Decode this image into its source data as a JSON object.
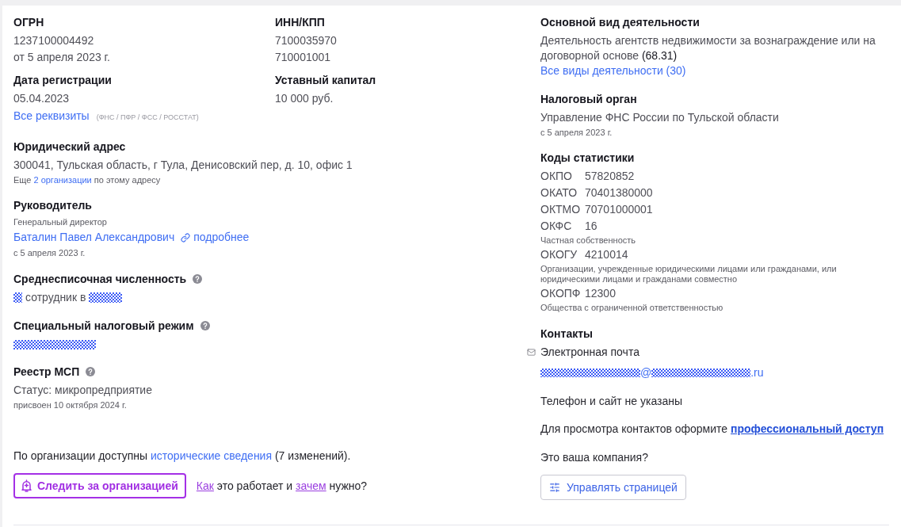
{
  "requisites": {
    "ogrn": {
      "label": "ОГРН",
      "values": [
        "1237100004492",
        "от 5 апреля 2023 г."
      ]
    },
    "inn_kpp": {
      "label": "ИНН/КПП",
      "values": [
        "7100035970",
        "710001001"
      ]
    },
    "registration_date": {
      "label": "Дата регистрации",
      "value": "05.04.2023"
    },
    "charter_capital": {
      "label": "Уставный капитал",
      "value": "10 000 руб."
    },
    "all_requisites": {
      "link": "Все реквизиты",
      "sources": "(ФНС / ПФР / ФСС / РОССТАТ)"
    }
  },
  "legal_address": {
    "label": "Юридический адрес",
    "value": "300041, Тульская область, г Тула, Денисовский пер, д. 10, офис 1",
    "note": {
      "before": "Еще",
      "link": "2 организации",
      "after": "по этому адресу"
    }
  },
  "director": {
    "label": "Руководитель",
    "position": "Генеральный директор",
    "name": "Баталин Павел Александрович",
    "details_link": "подробнее",
    "since": "с 5 апреля 2023 г."
  },
  "headcount": {
    "label": "Среднесписочная численность",
    "help": true,
    "parts": [
      {
        "kind": "masked"
      },
      {
        "kind": "text",
        "text": "сотрудник в"
      },
      {
        "kind": "masked"
      }
    ]
  },
  "tax_regime": {
    "label": "Специальный налоговый режим",
    "help": true,
    "parts": [
      {
        "kind": "masked"
      }
    ]
  },
  "sme_registry": {
    "label": "Реестр МСП",
    "help": true,
    "status": "Статус: микропредприятие",
    "assigned": "присвоен 10 октября 2024 г."
  },
  "history": {
    "before": "По организации доступны",
    "link": "исторические сведения",
    "after": "(7 изменений)."
  },
  "follow": {
    "button": "Следить за организацией",
    "help": {
      "link_1": "Как",
      "middle": "это работает и",
      "link_2": "зачем",
      "after": "нужно?"
    }
  },
  "main_activity": {
    "label": "Основной вид деятельности",
    "text": "Деятельность агентств недвижимости за вознаграждение или на договорной основе",
    "code": "(68.31)",
    "all_link": "Все виды деятельности (30)"
  },
  "tax_authority": {
    "label": "Налоговый орган",
    "value": "Управление ФНС России по Тульской области",
    "since": "с 5 апреля 2023 г."
  },
  "statistics_codes": {
    "label": "Коды статистики",
    "codes": [
      {
        "name": "ОКПО",
        "value": "57820852"
      },
      {
        "name": "ОКАТО",
        "value": "70401380000"
      },
      {
        "name": "ОКТМО",
        "value": "70701000001"
      },
      {
        "name": "ОКФС",
        "value": "16",
        "description": "Частная собственность"
      },
      {
        "name": "ОКОГУ",
        "value": "4210014",
        "description": "Организации, учрежденные юридическими лицами или гражданами, или юридическими лицами и гражданами совместно"
      },
      {
        "name": "ОКОПФ",
        "value": "12300",
        "description": "Общества с ограниченной ответственностью"
      }
    ]
  },
  "contacts": {
    "label": "Контакты",
    "email": {
      "label": "Электронная почта",
      "parts": [
        {
          "kind": "masked"
        },
        {
          "kind": "text",
          "text": "@"
        },
        {
          "kind": "masked"
        },
        {
          "kind": "text",
          "text": ".ru"
        }
      ]
    },
    "phone_note": "Телефон и сайт не указаны",
    "access_note": {
      "before": "Для просмотра контактов оформите",
      "link": "профессиональный доступ"
    },
    "question": "Это ваша компания?",
    "manage_button": "Управлять страницей"
  }
}
